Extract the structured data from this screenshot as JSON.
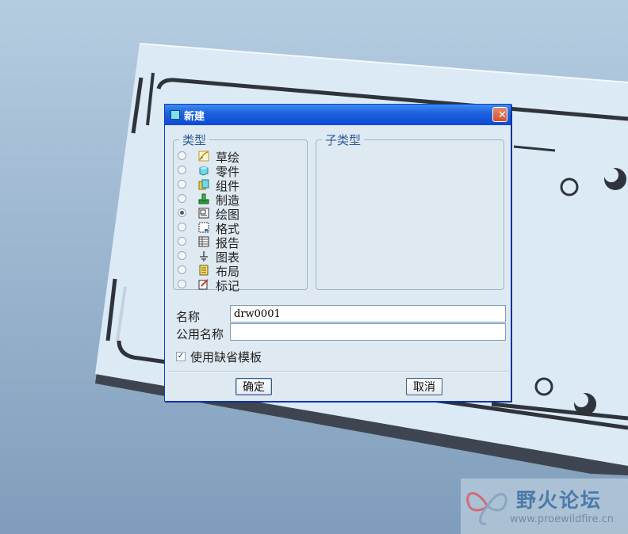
{
  "dialog": {
    "title": "新建",
    "close_symbol": "✕",
    "type_group_label": "类型",
    "subtype_group_label": "子类型",
    "types": [
      {
        "label": "草绘",
        "icon": "sketch-icon",
        "selected": false
      },
      {
        "label": "零件",
        "icon": "part-icon",
        "selected": false
      },
      {
        "label": "组件",
        "icon": "assembly-icon",
        "selected": false
      },
      {
        "label": "制造",
        "icon": "manufacturing-icon",
        "selected": false
      },
      {
        "label": "绘图",
        "icon": "drawing-icon",
        "selected": true
      },
      {
        "label": "格式",
        "icon": "format-icon",
        "selected": false
      },
      {
        "label": "报告",
        "icon": "report-icon",
        "selected": false
      },
      {
        "label": "图表",
        "icon": "diagram-icon",
        "selected": false
      },
      {
        "label": "布局",
        "icon": "layout-icon",
        "selected": false
      },
      {
        "label": "标记",
        "icon": "markup-icon",
        "selected": false
      }
    ],
    "name_label": "名称",
    "name_value": "drw0001",
    "common_name_label": "公用名称",
    "common_name_value": "",
    "use_default_template_label": "使用缺省模板",
    "use_default_template_checked": true,
    "check_mark": "✓",
    "ok_label": "确定",
    "cancel_label": "取消"
  },
  "watermark": {
    "text": "野火论坛",
    "url": "www.proewildfire.cn"
  },
  "colors": {
    "title_bar": "#1f63df",
    "dialog_bg": "#dfe9f1",
    "part_model": "#dbeaf5",
    "viewport_bg": "#9db7d0",
    "group_label": "#2a5a9a"
  }
}
